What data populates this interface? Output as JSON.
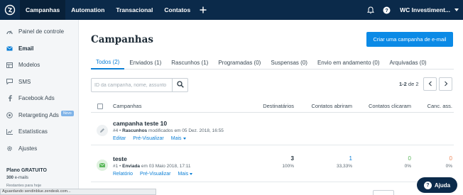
{
  "colors": {
    "topbar": "#0b2a4a",
    "accent": "#0b7fd6",
    "button": "#0b8ae6",
    "green": "#5cb85c",
    "orange": "#f08a5d"
  },
  "topnav": {
    "items": [
      "Campanhas",
      "Automation",
      "Transacional",
      "Contatos"
    ],
    "account": "WC Investiment..."
  },
  "sidebar": {
    "items": [
      {
        "label": "Painel de controle",
        "icon": "dashboard-icon"
      },
      {
        "label": "Email",
        "icon": "email-icon"
      },
      {
        "label": "Modelos",
        "icon": "templates-icon"
      },
      {
        "label": "SMS",
        "icon": "sms-icon"
      },
      {
        "label": "Facebook Ads",
        "icon": "facebook-icon"
      },
      {
        "label": "Retargeting Ads",
        "icon": "retargeting-icon"
      },
      {
        "label": "Estatísticas",
        "icon": "stats-icon"
      },
      {
        "label": "Ajustes",
        "icon": "settings-icon"
      }
    ],
    "new_badge": "Novo",
    "plan_title": "Plano GRATUITO",
    "plan_emails_count": "300",
    "plan_emails_suffix": " e-mails",
    "plan_remaining": "Restantes para hoje"
  },
  "statusbar": "Aguardando sendinblue.zendesk.com...",
  "main": {
    "title": "Campanhas",
    "create_button": "Criar uma campanha de e-mail",
    "tabs": [
      "Todos (2)",
      "Enviados (1)",
      "Rascunhos (1)",
      "Programadas (0)",
      "Suspensas (0)",
      "Envio em andamento (0)",
      "Arquivadas (0)"
    ],
    "search_placeholder": "ID da campanha, nome, assunto",
    "pager_range": "1-2",
    "pager_of": " de 2",
    "columns": {
      "name": "Campanhas",
      "recipients": "Destinatários",
      "opened": "Contatos abriram",
      "clicked": "Contatos clicaram",
      "unsub": "Canc. ass."
    },
    "rows": [
      {
        "name": "campanha teste 10",
        "id": "#4",
        "status": "Rascunhos",
        "date_text": "modificados em 05 Dez. 2018, 16:55",
        "actions": [
          "Editar",
          "Pré-Visualizar",
          "Mais"
        ]
      },
      {
        "name": "teste",
        "id": "#1",
        "status": "Enviada",
        "date_text": "em 03 Maio 2018, 17:11",
        "actions": [
          "Relatório",
          "Pré-Visualizar",
          "Mais"
        ],
        "recipients": "3",
        "recipients_pct": "100%",
        "opened": "1",
        "opened_pct": "33,33%",
        "clicked": "0",
        "clicked_pct": "0%",
        "unsub": "0",
        "unsub_pct": "0%"
      }
    ]
  },
  "help_label": "Ajuda"
}
